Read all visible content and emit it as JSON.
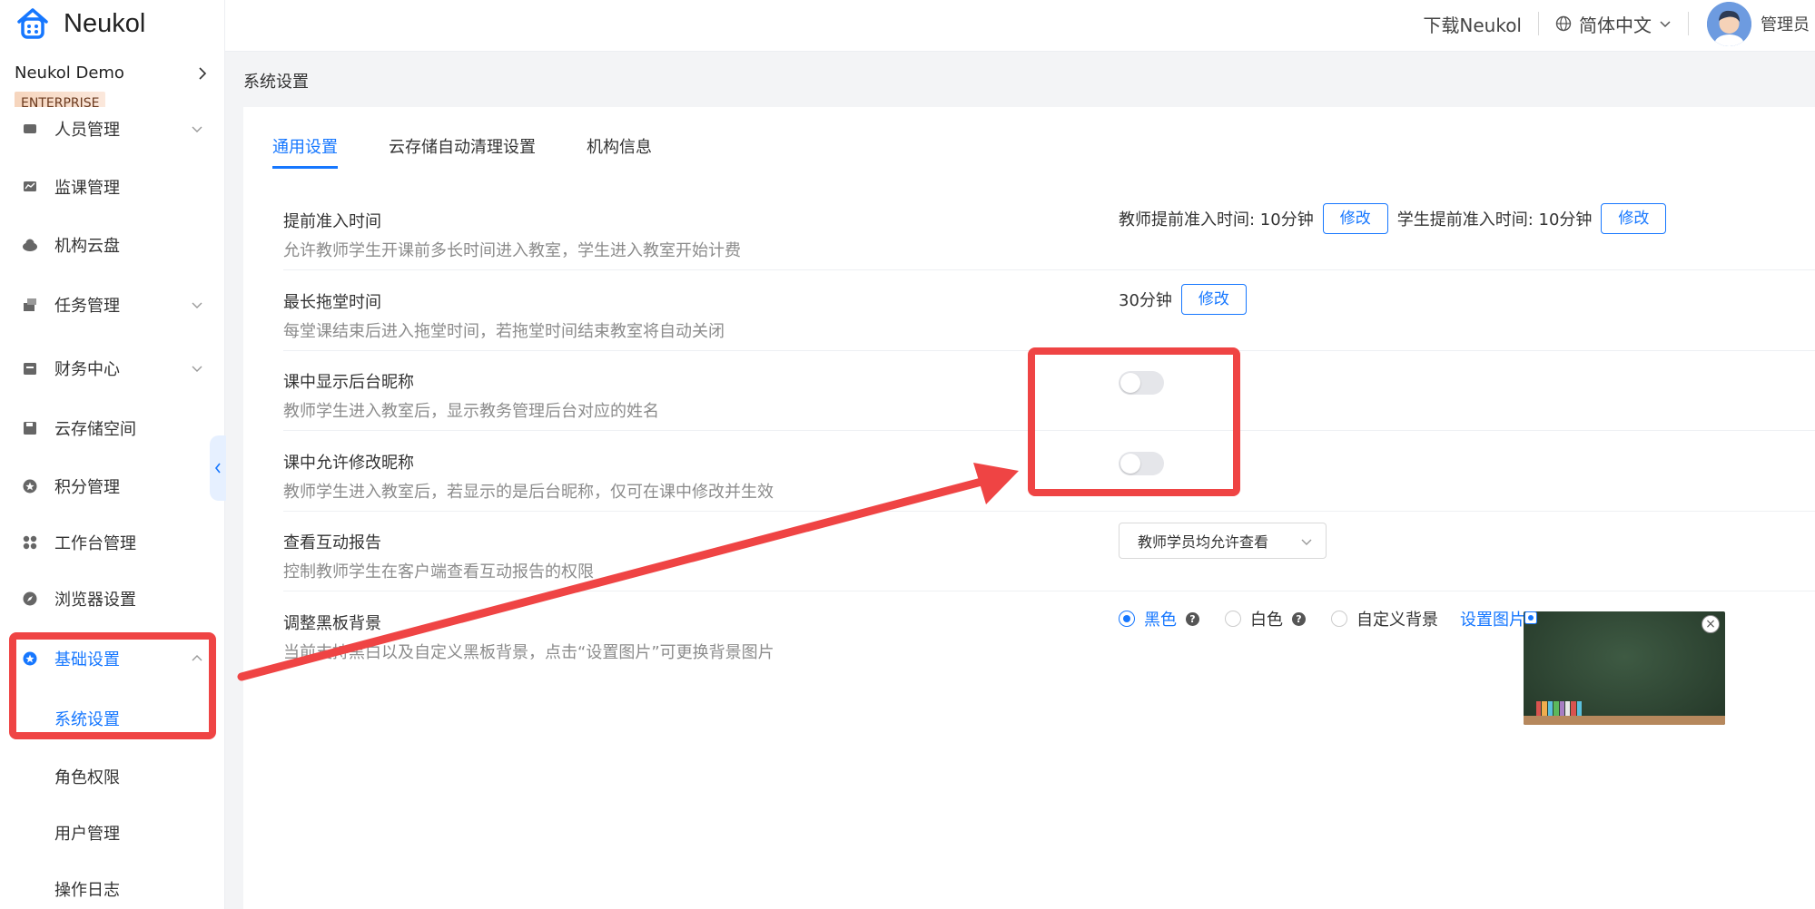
{
  "header": {
    "download_label": "下载Neukol",
    "language_label": "简体中文",
    "user_name": "管理员"
  },
  "sidebar": {
    "logo_text": "Neukol",
    "org_name": "Neukol Demo",
    "plan_badge": "ENTERPRISE",
    "items": [
      {
        "label": "人员管理",
        "icon": "people-icon"
      },
      {
        "label": "监课管理",
        "icon": "monitor-icon"
      },
      {
        "label": "机构云盘",
        "icon": "cloud-icon"
      },
      {
        "label": "任务管理",
        "icon": "task-icon"
      },
      {
        "label": "财务中心",
        "icon": "finance-icon"
      },
      {
        "label": "云存储空间",
        "icon": "storage-icon"
      },
      {
        "label": "积分管理",
        "icon": "points-icon"
      },
      {
        "label": "工作台管理",
        "icon": "workbench-icon"
      },
      {
        "label": "浏览器设置",
        "icon": "compass-icon"
      },
      {
        "label": "基础设置",
        "icon": "settings-icon"
      }
    ],
    "submenu": [
      {
        "label": "系统设置"
      },
      {
        "label": "角色权限"
      },
      {
        "label": "用户管理"
      },
      {
        "label": "操作日志"
      }
    ]
  },
  "main": {
    "breadcrumb": "系统设置",
    "tabs": [
      {
        "label": "通用设置"
      },
      {
        "label": "云存储自动清理设置"
      },
      {
        "label": "机构信息"
      }
    ],
    "settings": [
      {
        "title": "提前准入时间",
        "desc": "允许教师学生开课前多长时间进入教室，学生进入教室开始计费",
        "teacher_label": "教师提前准入时间: 10分钟",
        "student_label": "学生提前准入时间: 10分钟",
        "edit_label": "修改"
      },
      {
        "title": "最长拖堂时间",
        "desc": "每堂课结束后进入拖堂时间，若拖堂时间结束教室将自动关闭",
        "value": "30分钟",
        "edit_label": "修改"
      },
      {
        "title": "课中显示后台昵称",
        "desc": "教师学生进入教室后，显示教务管理后台对应的姓名",
        "enabled": false
      },
      {
        "title": "课中允许修改昵称",
        "desc": "教师学生进入教室后，若显示的是后台昵称，仅可在课中修改并生效",
        "enabled": false
      },
      {
        "title": "查看互动报告",
        "desc": "控制教师学生在客户端查看互动报告的权限",
        "selected": "教师学员均允许查看"
      },
      {
        "title": "调整黑板背景",
        "desc": "当前支持黑白以及自定义黑板背景，点击“设置图片”可更换背景图片",
        "options": [
          {
            "label": "黑色",
            "checked": true
          },
          {
            "label": "白色",
            "checked": false
          },
          {
            "label": "自定义背景",
            "checked": false
          }
        ],
        "set_image_label": "设置图片"
      }
    ]
  },
  "colors": {
    "accent": "#1677ff",
    "annotation": "#ef4444"
  }
}
